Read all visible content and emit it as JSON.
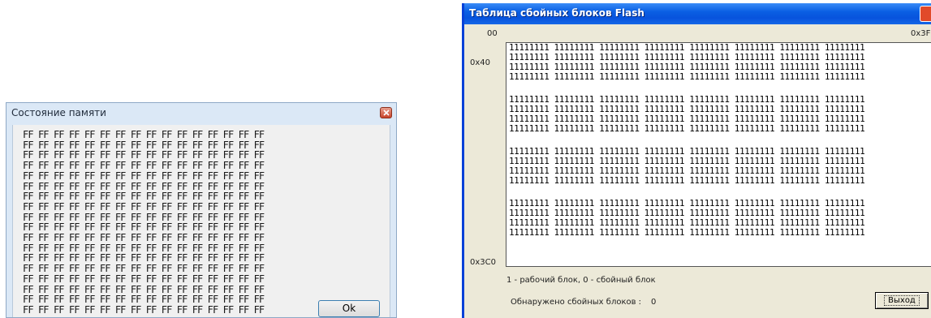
{
  "memory_dialog": {
    "title": "Состояние памяти",
    "rows": [
      "FF FF FF FF FF FF FF FF FF FF FF FF FF FF FF FF",
      "FF FF FF FF FF FF FF FF FF FF FF FF FF FF FF FF",
      "FF FF FF FF FF FF FF FF FF FF FF FF FF FF FF FF",
      "FF FF FF FF FF FF FF FF FF FF FF FF FF FF FF FF",
      "FF FF FF FF FF FF FF FF FF FF FF FF FF FF FF FF",
      "FF FF FF FF FF FF FF FF FF FF FF FF FF FF FF FF",
      "FF FF FF FF FF FF FF FF FF FF FF FF FF FF FF FF",
      "FF FF FF FF FF FF FF FF FF FF FF FF FF FF FF FF",
      "FF FF FF FF FF FF FF FF FF FF FF FF FF FF FF FF",
      "FF FF FF FF FF FF FF FF FF FF FF FF FF FF FF FF",
      "FF FF FF FF FF FF FF FF FF FF FF FF FF FF FF FF",
      "FF FF FF FF FF FF FF FF FF FF FF FF FF FF FF FF",
      "FF FF FF FF FF FF FF FF FF FF FF FF FF FF FF FF",
      "FF FF FF FF FF FF FF FF FF FF FF FF FF FF FF FF",
      "FF FF FF FF FF FF FF FF FF FF FF FF FF FF FF FF",
      "FF FF FF FF FF FF FF FF FF FF FF FF FF FF FF FF",
      "FF FF FF FF FF FF FF FF FF FF FF FF FF FF FF FF",
      "FF FF FF FF FF FF FF FF FF FF FF FF FF FF FF FF"
    ],
    "ok_label": "Ok",
    "close_icon": "close-icon"
  },
  "flash_dialog": {
    "title": "Таблица сбойных блоков Flash",
    "col_start": "00",
    "col_end": "0x3F",
    "row_label_first": "0x40",
    "row_label_last": "0x3C0",
    "block_rows": 16,
    "row_text": "11111111 11111111 11111111 11111111 11111111 11111111 11111111 11111111",
    "legend": "1 - рабочий блок, 0 - сбойный блок",
    "bad_blocks_label": "Обнаружено сбойных блоков :",
    "bad_blocks_count": "0",
    "exit_label": "Выход",
    "close_icon": "close-icon"
  }
}
